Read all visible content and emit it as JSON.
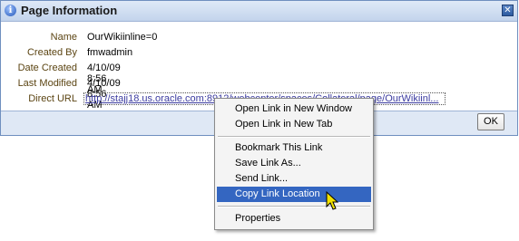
{
  "dialog": {
    "title": "Page Information",
    "title_icon": "info-icon",
    "close_icon": "close-icon",
    "close_glyph": "✕",
    "fields": [
      {
        "label": "Name",
        "value": "OurWikiinline=0"
      },
      {
        "label": "Created By",
        "value": "fmwadmin"
      },
      {
        "label": "Date Created",
        "value": "4/10/09 8:56 AM"
      },
      {
        "label": "Last Modified",
        "value": "4/10/09 8:56 AM"
      },
      {
        "label": "Direct URL",
        "value": "http://stajj18.us.oracle.com:8912/webcenter/spaces/Collateral/page/OurWikiinl..."
      }
    ],
    "ok_label": "OK"
  },
  "context_menu": {
    "items": [
      {
        "label": "Open Link in New Window",
        "highlighted": false
      },
      {
        "label": "Open Link in New Tab",
        "highlighted": false
      },
      {
        "label": "Bookmark This Link",
        "highlighted": false
      },
      {
        "label": "Save Link As...",
        "highlighted": false
      },
      {
        "label": "Send Link...",
        "highlighted": false
      },
      {
        "label": "Copy Link Location",
        "highlighted": true
      },
      {
        "label": "Properties",
        "highlighted": false
      }
    ],
    "highlight_color": "#3466c1"
  },
  "colors": {
    "label_color": "#5b4412",
    "link_color": "#3c3ca0"
  }
}
